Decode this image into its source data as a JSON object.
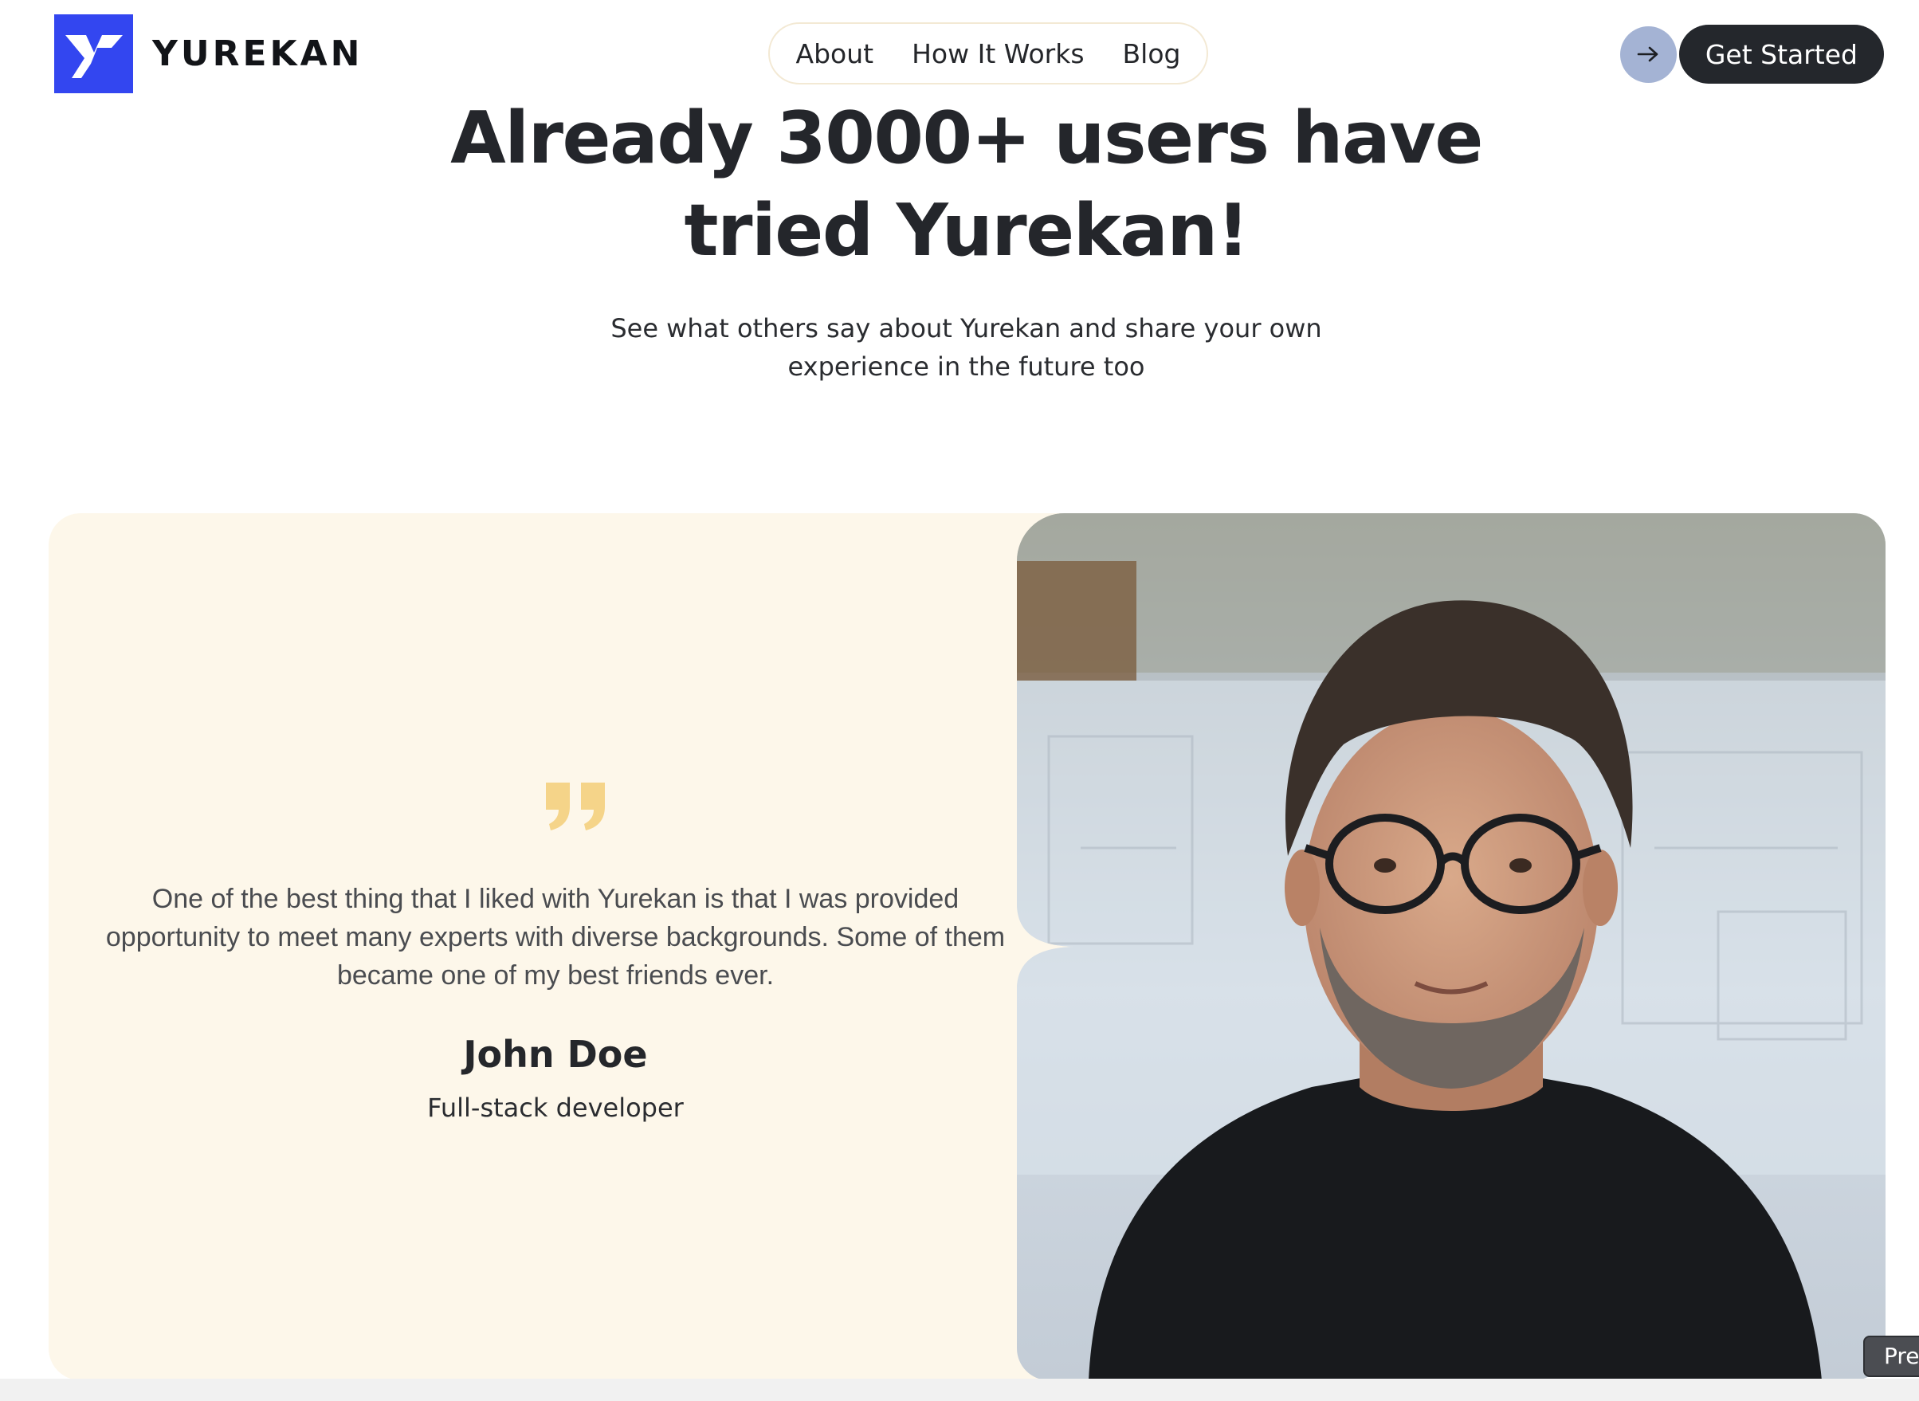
{
  "brand": {
    "name": "YUREKAN",
    "logo_icon": "y-logo-icon",
    "color": "#3346f0"
  },
  "nav": {
    "items": [
      {
        "label": "About"
      },
      {
        "label": "How It Works"
      },
      {
        "label": "Blog"
      }
    ]
  },
  "cta": {
    "arrow_icon": "arrow-right-icon",
    "label": "Get Started"
  },
  "hero": {
    "title_line1": "Already 3000+ users have",
    "title_line2": "tried Yurekan!",
    "subtitle_line1": "See what others say about Yurekan and share your own",
    "subtitle_line2": "experience in the future too"
  },
  "testimonial": {
    "quote_icon": "quote-icon",
    "quote_line1": "One of the best thing that I liked with Yurekan is that I was provided",
    "quote_line2": "opportunity to meet many experts with diverse backgrounds. Some of them",
    "quote_line3": "became one of my best friends ever.",
    "author": "John Doe",
    "role": "Full-stack developer",
    "photo": "portrait-photo"
  },
  "preview_tag": "Pre",
  "colors": {
    "card_bg": "#fdf7ea",
    "quote_accent": "#f5d489",
    "cta_bg": "#24272c",
    "arrow_bg": "#a4b3d4"
  }
}
